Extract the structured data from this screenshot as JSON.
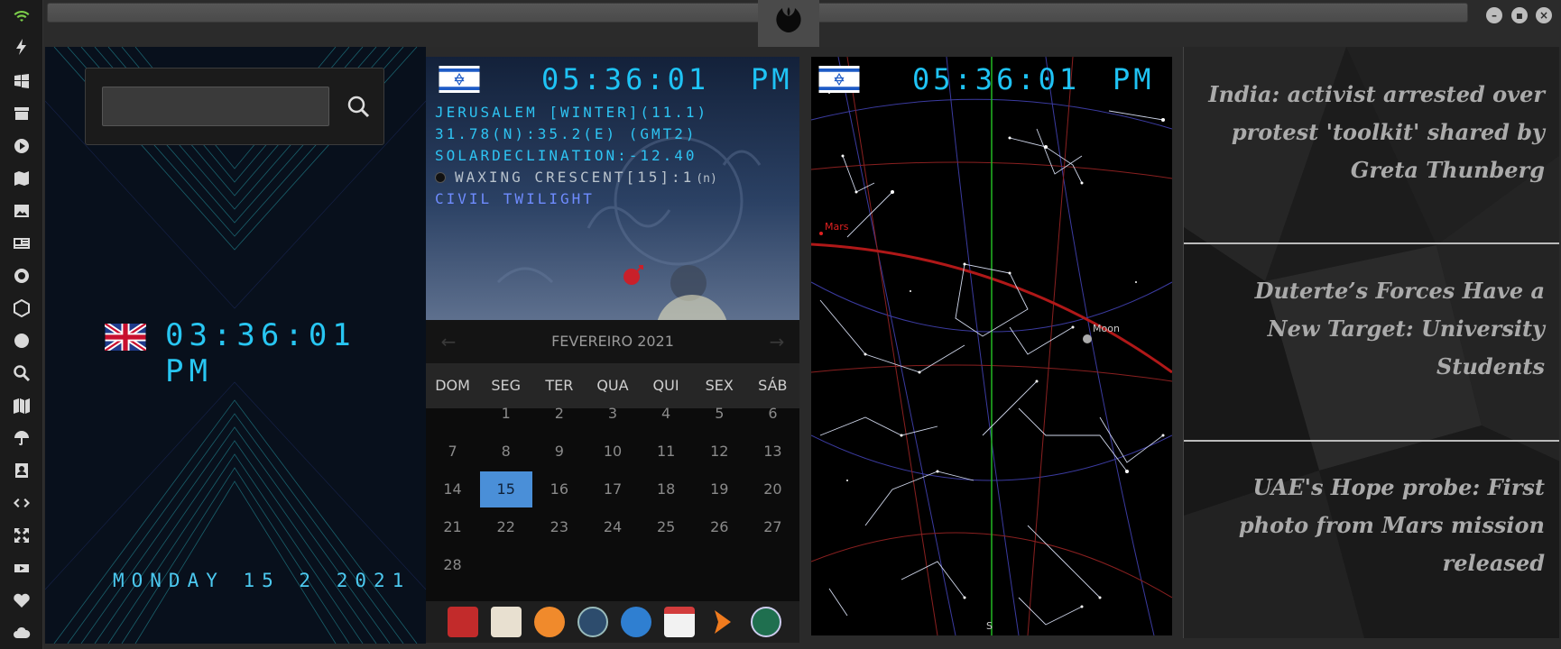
{
  "top": {
    "minimize_label": "–",
    "maximize_label": "▪",
    "close_label": "×"
  },
  "left_bar": {
    "icons": [
      "wifi-icon",
      "lightning-icon",
      "windows-icon",
      "archive-icon",
      "play-icon",
      "map-icon",
      "image-icon",
      "news-icon",
      "rebel-icon",
      "hexagon-icon",
      "globe-icon",
      "search-icon",
      "folded-map-icon",
      "umbrella-icon",
      "contacts-icon",
      "code-icon",
      "expand-icon",
      "youtube-icon",
      "heart-icon",
      "cloud-icon"
    ]
  },
  "uk_panel": {
    "search": {
      "value": "",
      "placeholder": ""
    },
    "time": "03:36:01 PM",
    "date": "MONDAY 15 2 2021"
  },
  "il_panel": {
    "time": "05:36:01",
    "ampm": "PM",
    "location": "JERUSALEM [WINTER](11.1)",
    "coords": "31.78(N):35.2(E) (GMT2)",
    "solar": "SOLARDECLINATION:-12.40",
    "moon": "WAXING CRESCENT[15]:1",
    "moon_suffix": "(n)",
    "twilight": "CIVIL TWILIGHT",
    "calendar": {
      "month": "FEVEREIRO 2021",
      "prev": "←",
      "next": "→",
      "days_of_week": [
        "DOM",
        "SEG",
        "TER",
        "QUA",
        "QUI",
        "SEX",
        "SÁB"
      ],
      "days": [
        "1",
        "2",
        "3",
        "4",
        "5",
        "6",
        "7",
        "8",
        "9",
        "10",
        "11",
        "12",
        "13",
        "14",
        "15",
        "16",
        "17",
        "18",
        "19",
        "20",
        "21",
        "22",
        "23",
        "24",
        "25",
        "26",
        "27",
        "28"
      ],
      "selected": "15"
    },
    "dock": [
      "pdf-app-icon",
      "calendar-notes-icon",
      "search-app-icon",
      "clock-app-icon",
      "globe-app-icon",
      "calendar-app-icon",
      "arrow-app-icon",
      "rebel-app-icon"
    ]
  },
  "sky_panel": {
    "time": "05:36:01",
    "ampm": "PM",
    "mars_label": "Mars",
    "moon_label": "Moon",
    "south_label": "S"
  },
  "news_panel": {
    "items": [
      "India: activist arrested over protest 'toolkit' shared by Greta Thunberg",
      "Duterte’s Forces Have a New Target: University Students",
      "UAE's Hope probe: First photo from Mars mission released"
    ]
  }
}
